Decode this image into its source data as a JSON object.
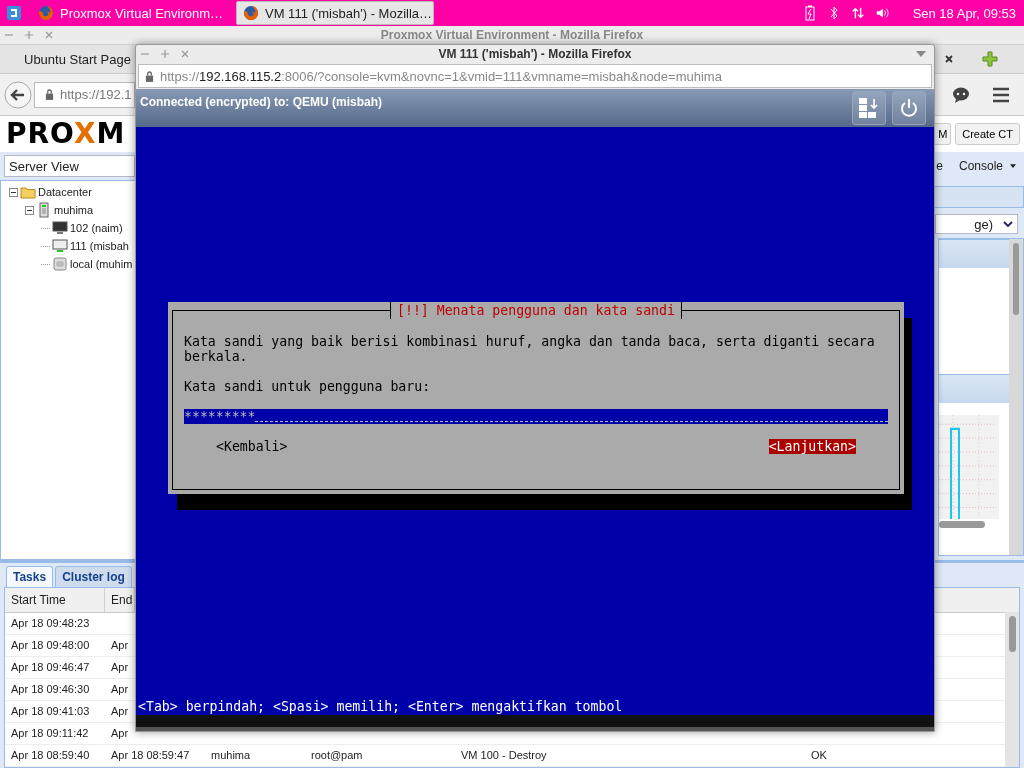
{
  "panel": {
    "tasks": [
      {
        "title": "Proxmox Virtual Environm…",
        "selected": false
      },
      {
        "title": "VM 111 ('misbah') - Mozilla…",
        "selected": true
      }
    ],
    "clock": "Sen 18 Apr, 09:53"
  },
  "back_window": {
    "title": "Proxmox Virtual Environment - Mozilla Firefox",
    "tab": "Ubuntu Start Page",
    "url": "https://192.1"
  },
  "proxmox": {
    "logo": [
      {
        "text": "PRO",
        "accent": false
      },
      {
        "text": "X",
        "accent": true
      },
      {
        "text": "M",
        "accent": false
      }
    ],
    "header_buttons": [
      "M",
      "Create CT"
    ],
    "toolbar": [
      {
        "label": "e",
        "kind": "text"
      },
      {
        "label": "Console",
        "kind": "menu"
      }
    ],
    "view_select": "Server View",
    "tree": [
      {
        "label": "Datacenter",
        "kind": "datacenter",
        "expanded": true,
        "children": [
          {
            "label": "muhima",
            "kind": "node",
            "expanded": true,
            "children": [
              {
                "label": "102 (naim)",
                "kind": "vm",
                "running": false
              },
              {
                "label": "111 (misbah",
                "kind": "vm",
                "running": true
              },
              {
                "label": "local (muhim",
                "kind": "storage"
              }
            ]
          }
        ]
      }
    ],
    "right_select": "ge)",
    "bottom_tabs": [
      {
        "label": "Tasks",
        "selected": true
      },
      {
        "label": "Cluster log",
        "selected": false
      }
    ],
    "table": {
      "columns": [
        "Start Time",
        "End"
      ],
      "rows": [
        [
          "Apr 18 09:48:23"
        ],
        [
          "Apr 18 09:48:00",
          "Apr"
        ],
        [
          "Apr 18 09:46:47",
          "Apr"
        ],
        [
          "Apr 18 09:46:30",
          "Apr"
        ],
        [
          "Apr 18 09:41:03",
          "Apr"
        ],
        [
          "Apr 18 09:11:42",
          "Apr"
        ],
        [
          "Apr 18 08:59:40",
          "Apr 18 08:59:47",
          "muhima",
          "root@pam",
          "VM 100 - Destroy",
          "OK"
        ]
      ]
    }
  },
  "vm_window": {
    "title": "VM 111 ('misbah') - Mozilla Firefox",
    "url": {
      "scheme": "https://",
      "host": "192.168.115.2",
      "rest": ":8006/?console=kvm&novnc=1&vmid=111&vmname=misbah&node=muhima"
    },
    "status": "Connected (encrypted) to: QEMU (misbah)",
    "dialog": {
      "title": "[!!] Menata pengguna dan kata sandi",
      "message": "Kata sandi yang baik berisi kombinasi huruf, angka dan tanda baca, serta diganti secara berkala.",
      "prompt": "Kata sandi untuk pengguna baru:",
      "password": "*********",
      "buttons": [
        {
          "label": "<Kembali>",
          "selected": false
        },
        {
          "label": "<Lanjutkan>",
          "selected": true
        }
      ]
    },
    "help": "<Tab> berpindah; <Spasi> memilih; <Enter> mengaktifkan tombol"
  }
}
